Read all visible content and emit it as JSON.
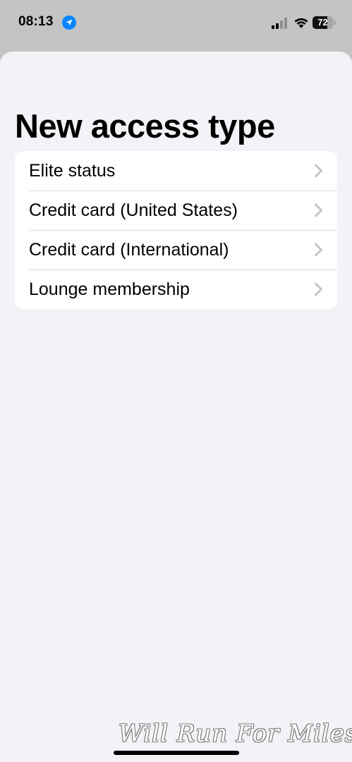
{
  "status_bar": {
    "time": "08:13",
    "battery_level": "72",
    "battery_fraction": 0.72,
    "icons": [
      "location-arrow-icon",
      "cellular-signal-icon",
      "wifi-icon",
      "battery-icon"
    ]
  },
  "page": {
    "title": "New access type"
  },
  "access_types": [
    {
      "label": "Elite status"
    },
    {
      "label": "Credit card (United States)"
    },
    {
      "label": "Credit card (International)"
    },
    {
      "label": "Lounge membership"
    }
  ],
  "watermark": "Will Run For Miles",
  "colors": {
    "accent": "#0a84ff",
    "background": "#f2f2f7",
    "chevron": "#c4c4c7"
  }
}
